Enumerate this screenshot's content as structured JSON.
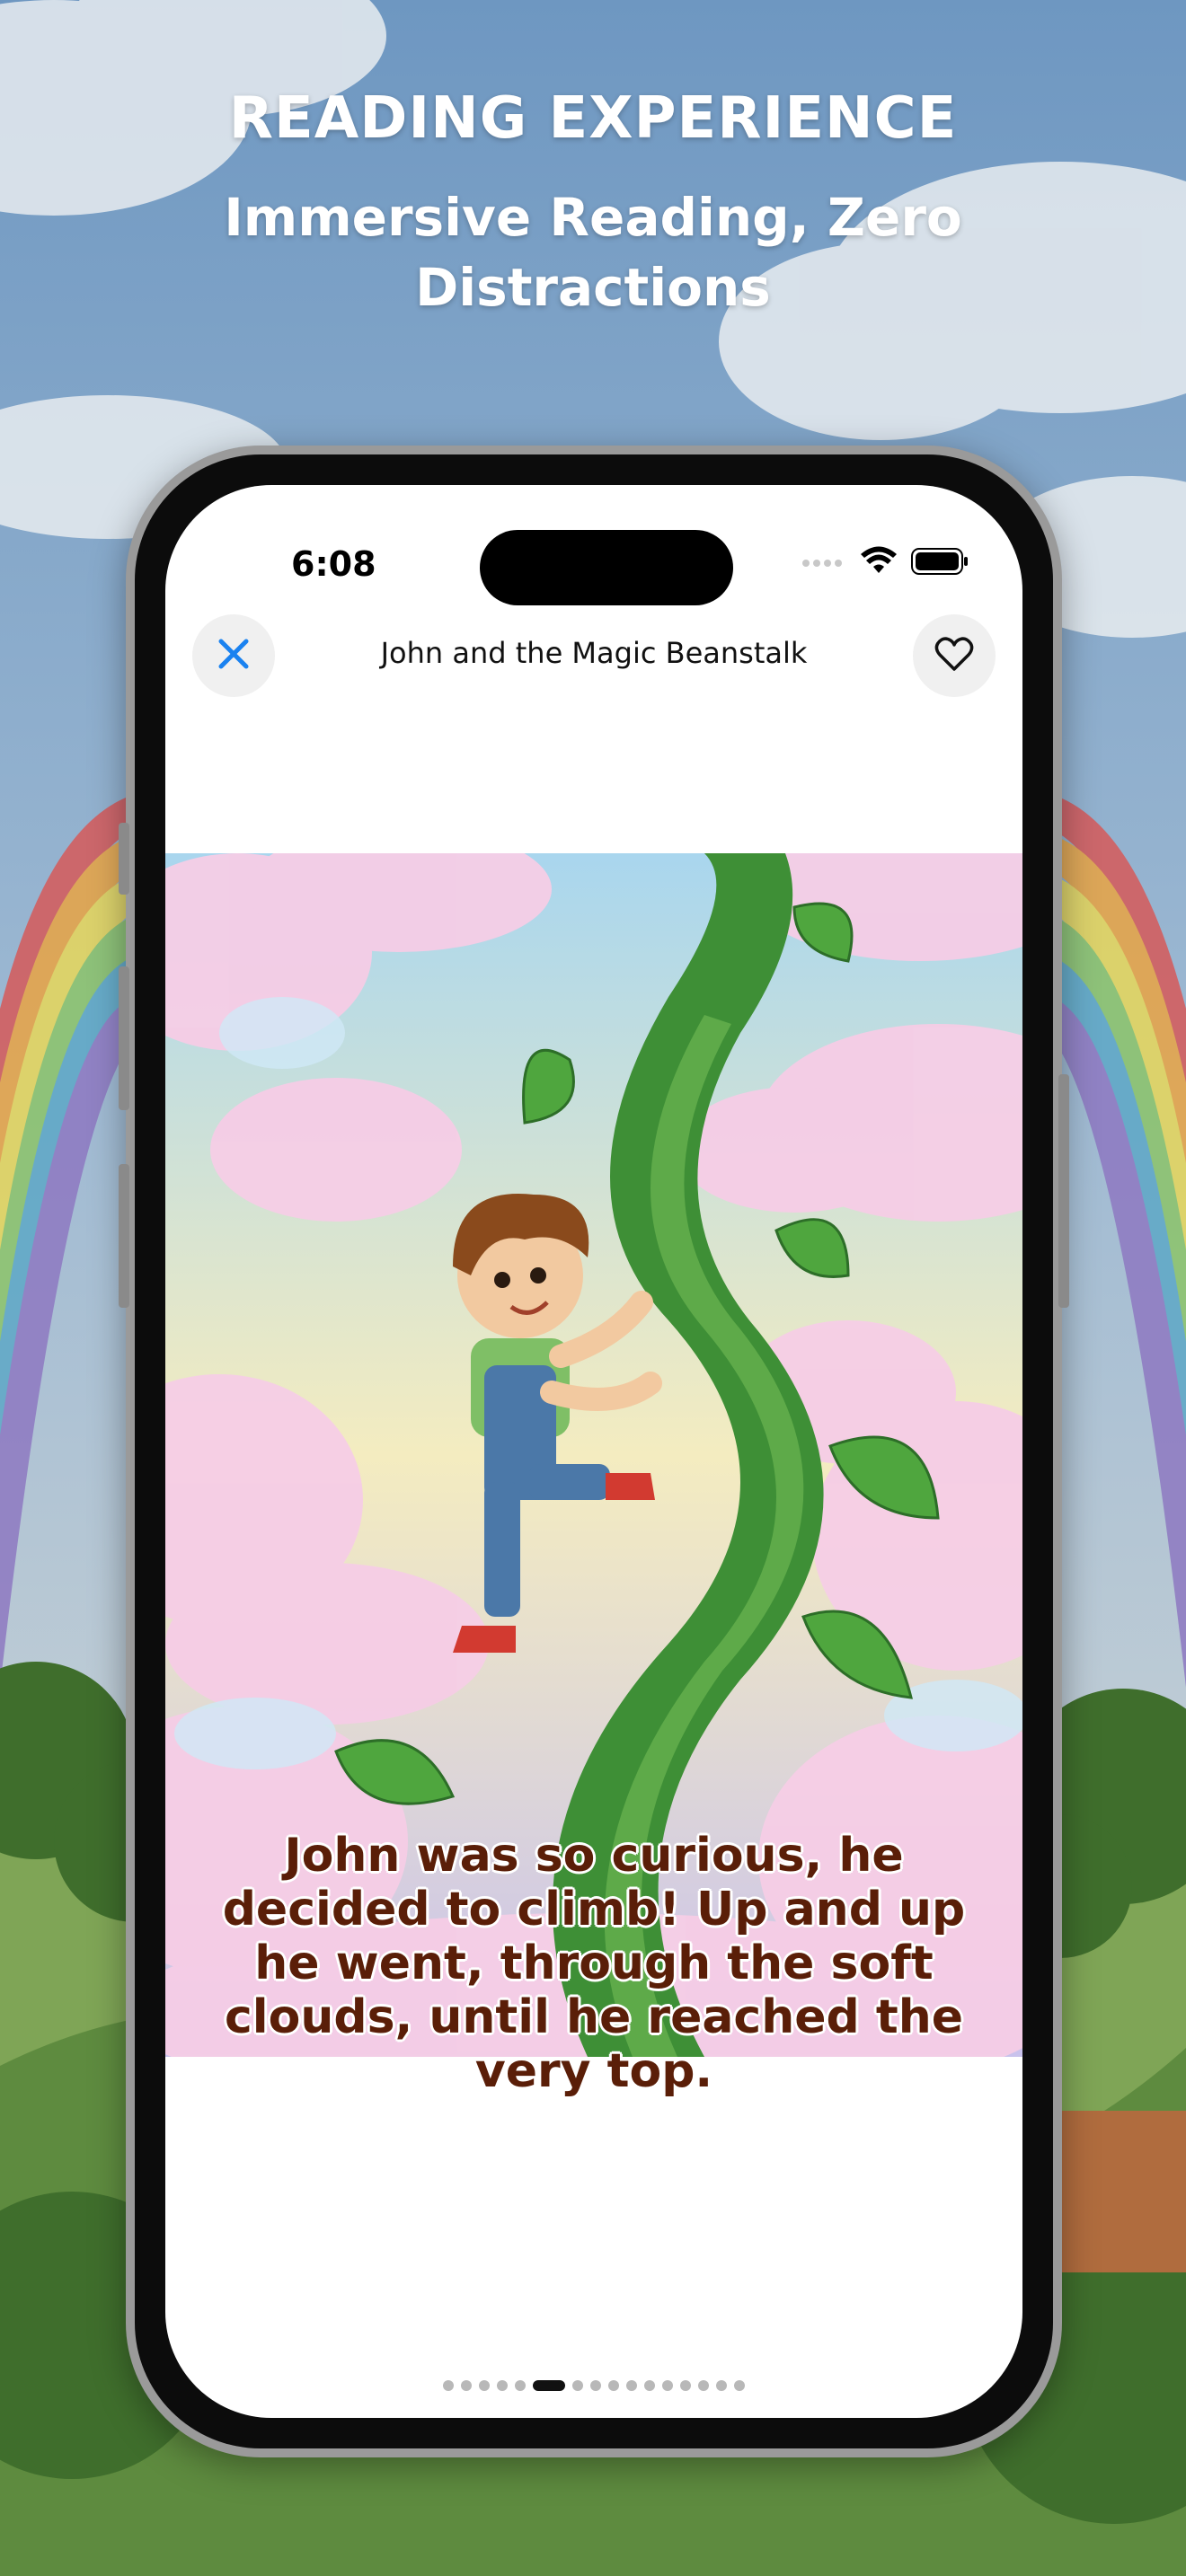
{
  "header": {
    "kicker": "READING EXPERIENCE",
    "subtitle": "Immersive Reading, Zero Distractions"
  },
  "status_bar": {
    "time": "6:08"
  },
  "reader": {
    "title": "John and the Magic Beanstalk",
    "close_icon": "close-icon",
    "favorite_icon": "heart-outline-icon",
    "page_text": "John was so curious, he decided to climb! Up and up he went, through the soft clouds, until he reached the very top.",
    "pagination": {
      "total_pages": 16,
      "current_page": 6
    }
  },
  "colors": {
    "accent": "#1a82f0",
    "caption": "#5a1e08",
    "sky": "#bfe1f0",
    "beanstalk": "#3e8f36"
  }
}
